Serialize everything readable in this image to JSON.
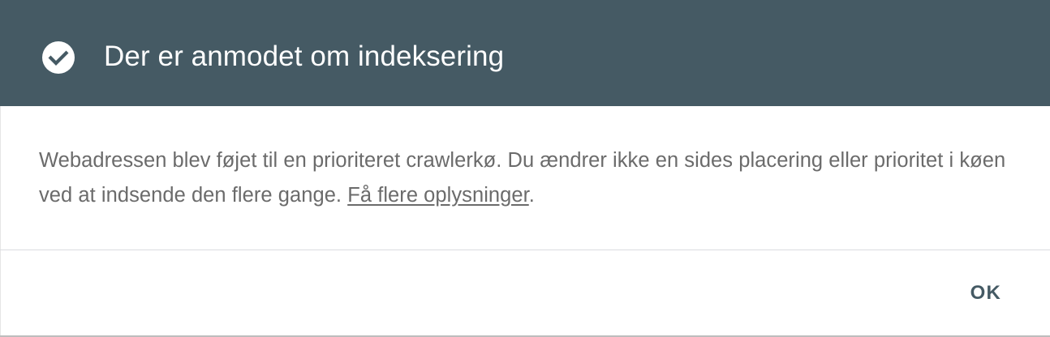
{
  "dialog": {
    "title": "Der er anmodet om indeksering",
    "header_color": "#455a64",
    "header_icon": "check-circle-icon",
    "body_text_before_link": "Webadressen blev føjet til en prioriteret crawlerkø. Du ændrer ikke en sides placering eller prioritet i køen ved at indsende den flere gange. ",
    "learn_more_link": "Få flere oplysninger",
    "body_text_after_link": ".",
    "ok_label": "OK"
  }
}
